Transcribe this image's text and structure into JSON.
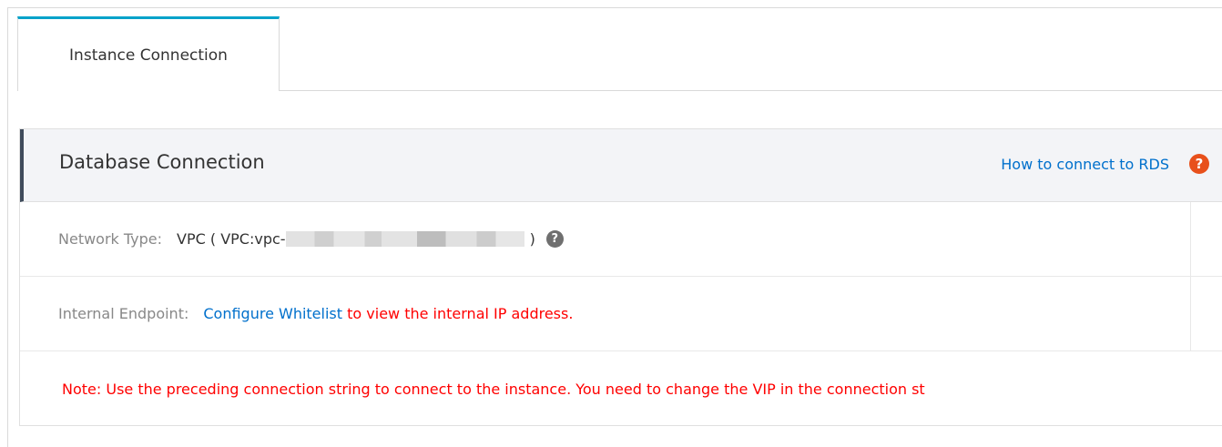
{
  "tabs": [
    {
      "label": "Instance Connection",
      "active": true
    }
  ],
  "section": {
    "title": "Database Connection",
    "help_link": "How to connect to RDS",
    "help_icon": "question-circle-icon"
  },
  "network": {
    "label": "Network Type:",
    "value_prefix": "VPC  ( VPC:vpc-",
    "value_suffix": ")",
    "info_icon": "question-circle-icon"
  },
  "endpoint": {
    "label": "Internal Endpoint:",
    "link_configure": "Configure",
    "link_whitelist": "Whitelist",
    "suffix": "to view the internal IP address."
  },
  "note": "Note: Use the preceding connection string to connect to the instance. You need to change the VIP in the connection st",
  "colors": {
    "accent": "#00a2ca",
    "link": "#0070cc",
    "warning": "#ff0000",
    "help_badge": "#e8501b"
  }
}
